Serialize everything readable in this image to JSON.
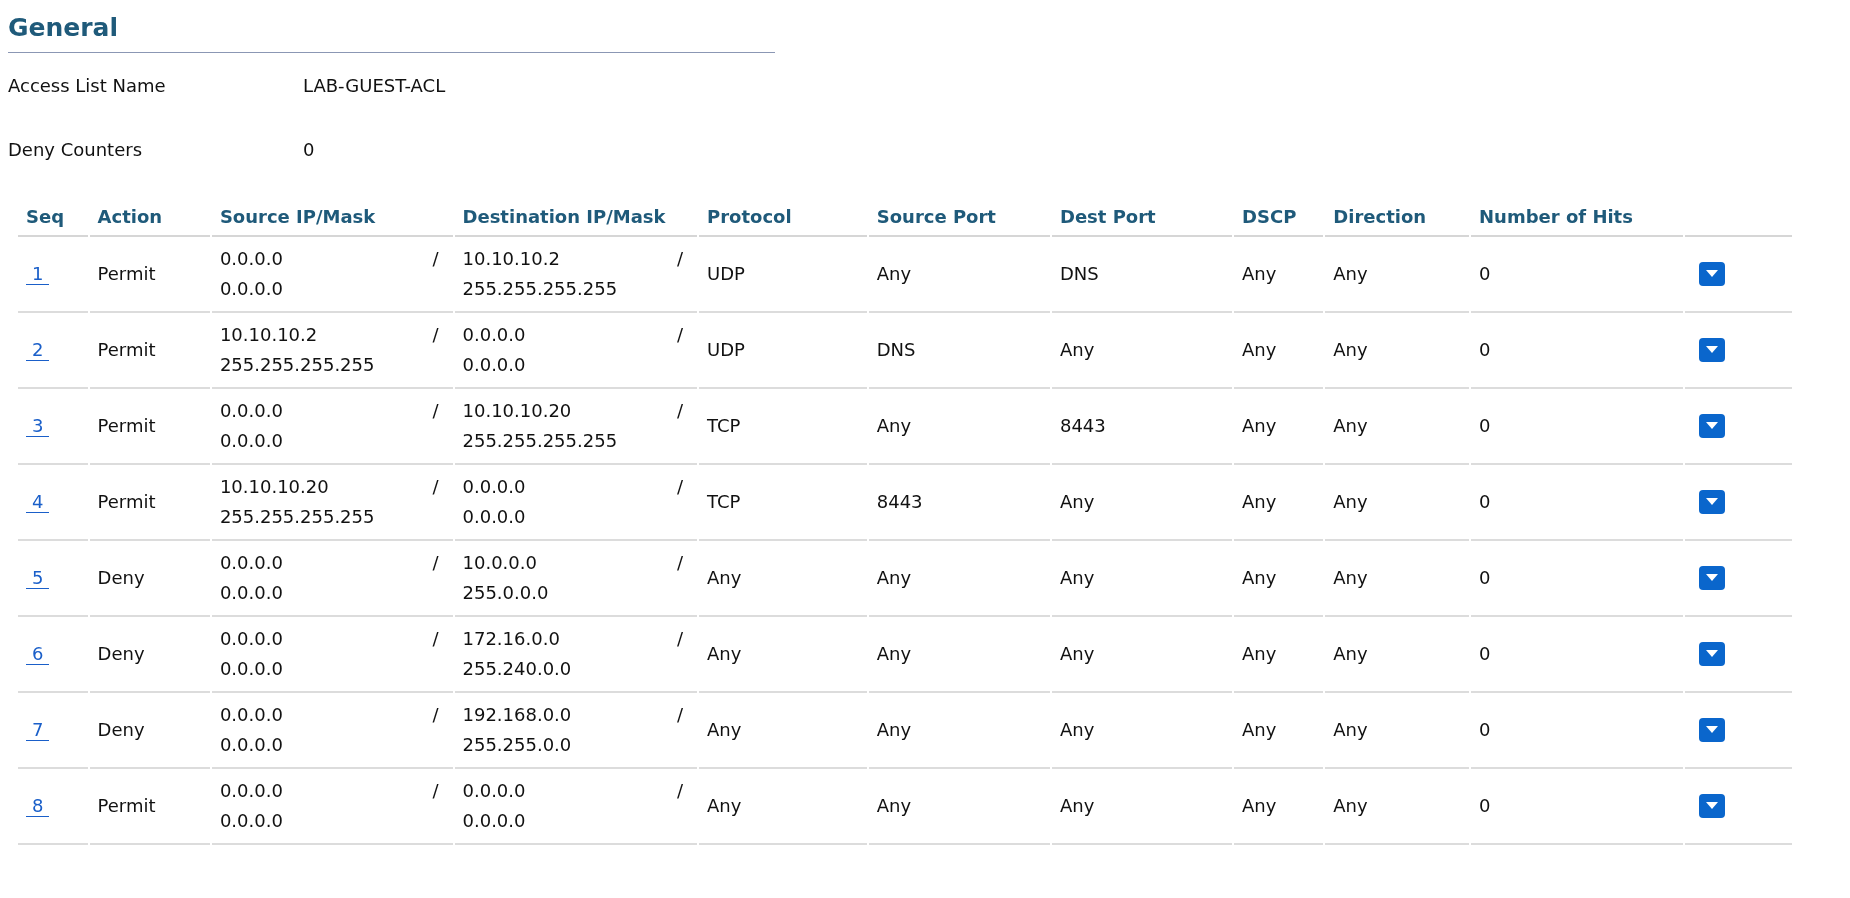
{
  "section": {
    "title": "General"
  },
  "fields": [
    {
      "label": "Access List Name",
      "value": "LAB-GUEST-ACL"
    },
    {
      "label": "Deny Counters",
      "value": "0"
    }
  ],
  "table": {
    "columns": [
      "Seq",
      "Action",
      "Source IP/Mask",
      "Destination IP/Mask",
      "Protocol",
      "Source Port",
      "Dest Port",
      "DSCP",
      "Direction",
      "Number of Hits"
    ],
    "rows": [
      {
        "seq": "1",
        "action": "Permit",
        "source": {
          "address": "0.0.0.0",
          "separator": "/",
          "mask": "0.0.0.0"
        },
        "destination": {
          "address": "10.10.10.2",
          "separator": "/",
          "mask": "255.255.255.255"
        },
        "protocol": "UDP",
        "source_port": "Any",
        "dest_port": "DNS",
        "dscp": "Any",
        "direction": "Any",
        "hits": "0"
      },
      {
        "seq": "2",
        "action": "Permit",
        "source": {
          "address": "10.10.10.2",
          "separator": "/",
          "mask": "255.255.255.255"
        },
        "destination": {
          "address": "0.0.0.0",
          "separator": "/",
          "mask": "0.0.0.0"
        },
        "protocol": "UDP",
        "source_port": "DNS",
        "dest_port": "Any",
        "dscp": "Any",
        "direction": "Any",
        "hits": "0"
      },
      {
        "seq": "3",
        "action": "Permit",
        "source": {
          "address": "0.0.0.0",
          "separator": "/",
          "mask": "0.0.0.0"
        },
        "destination": {
          "address": "10.10.10.20",
          "separator": "/",
          "mask": "255.255.255.255"
        },
        "protocol": "TCP",
        "source_port": "Any",
        "dest_port": "8443",
        "dscp": "Any",
        "direction": "Any",
        "hits": "0"
      },
      {
        "seq": "4",
        "action": "Permit",
        "source": {
          "address": "10.10.10.20",
          "separator": "/",
          "mask": "255.255.255.255"
        },
        "destination": {
          "address": "0.0.0.0",
          "separator": "/",
          "mask": "0.0.0.0"
        },
        "protocol": "TCP",
        "source_port": "8443",
        "dest_port": "Any",
        "dscp": "Any",
        "direction": "Any",
        "hits": "0"
      },
      {
        "seq": "5",
        "action": "Deny",
        "source": {
          "address": "0.0.0.0",
          "separator": "/",
          "mask": "0.0.0.0"
        },
        "destination": {
          "address": "10.0.0.0",
          "separator": "/",
          "mask": "255.0.0.0"
        },
        "protocol": "Any",
        "source_port": "Any",
        "dest_port": "Any",
        "dscp": "Any",
        "direction": "Any",
        "hits": "0"
      },
      {
        "seq": "6",
        "action": "Deny",
        "source": {
          "address": "0.0.0.0",
          "separator": "/",
          "mask": "0.0.0.0"
        },
        "destination": {
          "address": "172.16.0.0",
          "separator": "/",
          "mask": "255.240.0.0"
        },
        "protocol": "Any",
        "source_port": "Any",
        "dest_port": "Any",
        "dscp": "Any",
        "direction": "Any",
        "hits": "0"
      },
      {
        "seq": "7",
        "action": "Deny",
        "source": {
          "address": "0.0.0.0",
          "separator": "/",
          "mask": "0.0.0.0"
        },
        "destination": {
          "address": "192.168.0.0",
          "separator": "/",
          "mask": "255.255.0.0"
        },
        "protocol": "Any",
        "source_port": "Any",
        "dest_port": "Any",
        "dscp": "Any",
        "direction": "Any",
        "hits": "0"
      },
      {
        "seq": "8",
        "action": "Permit",
        "source": {
          "address": "0.0.0.0",
          "separator": "/",
          "mask": "0.0.0.0"
        },
        "destination": {
          "address": "0.0.0.0",
          "separator": "/",
          "mask": "0.0.0.0"
        },
        "protocol": "Any",
        "source_port": "Any",
        "dest_port": "Any",
        "dscp": "Any",
        "direction": "Any",
        "hits": "0"
      }
    ]
  }
}
